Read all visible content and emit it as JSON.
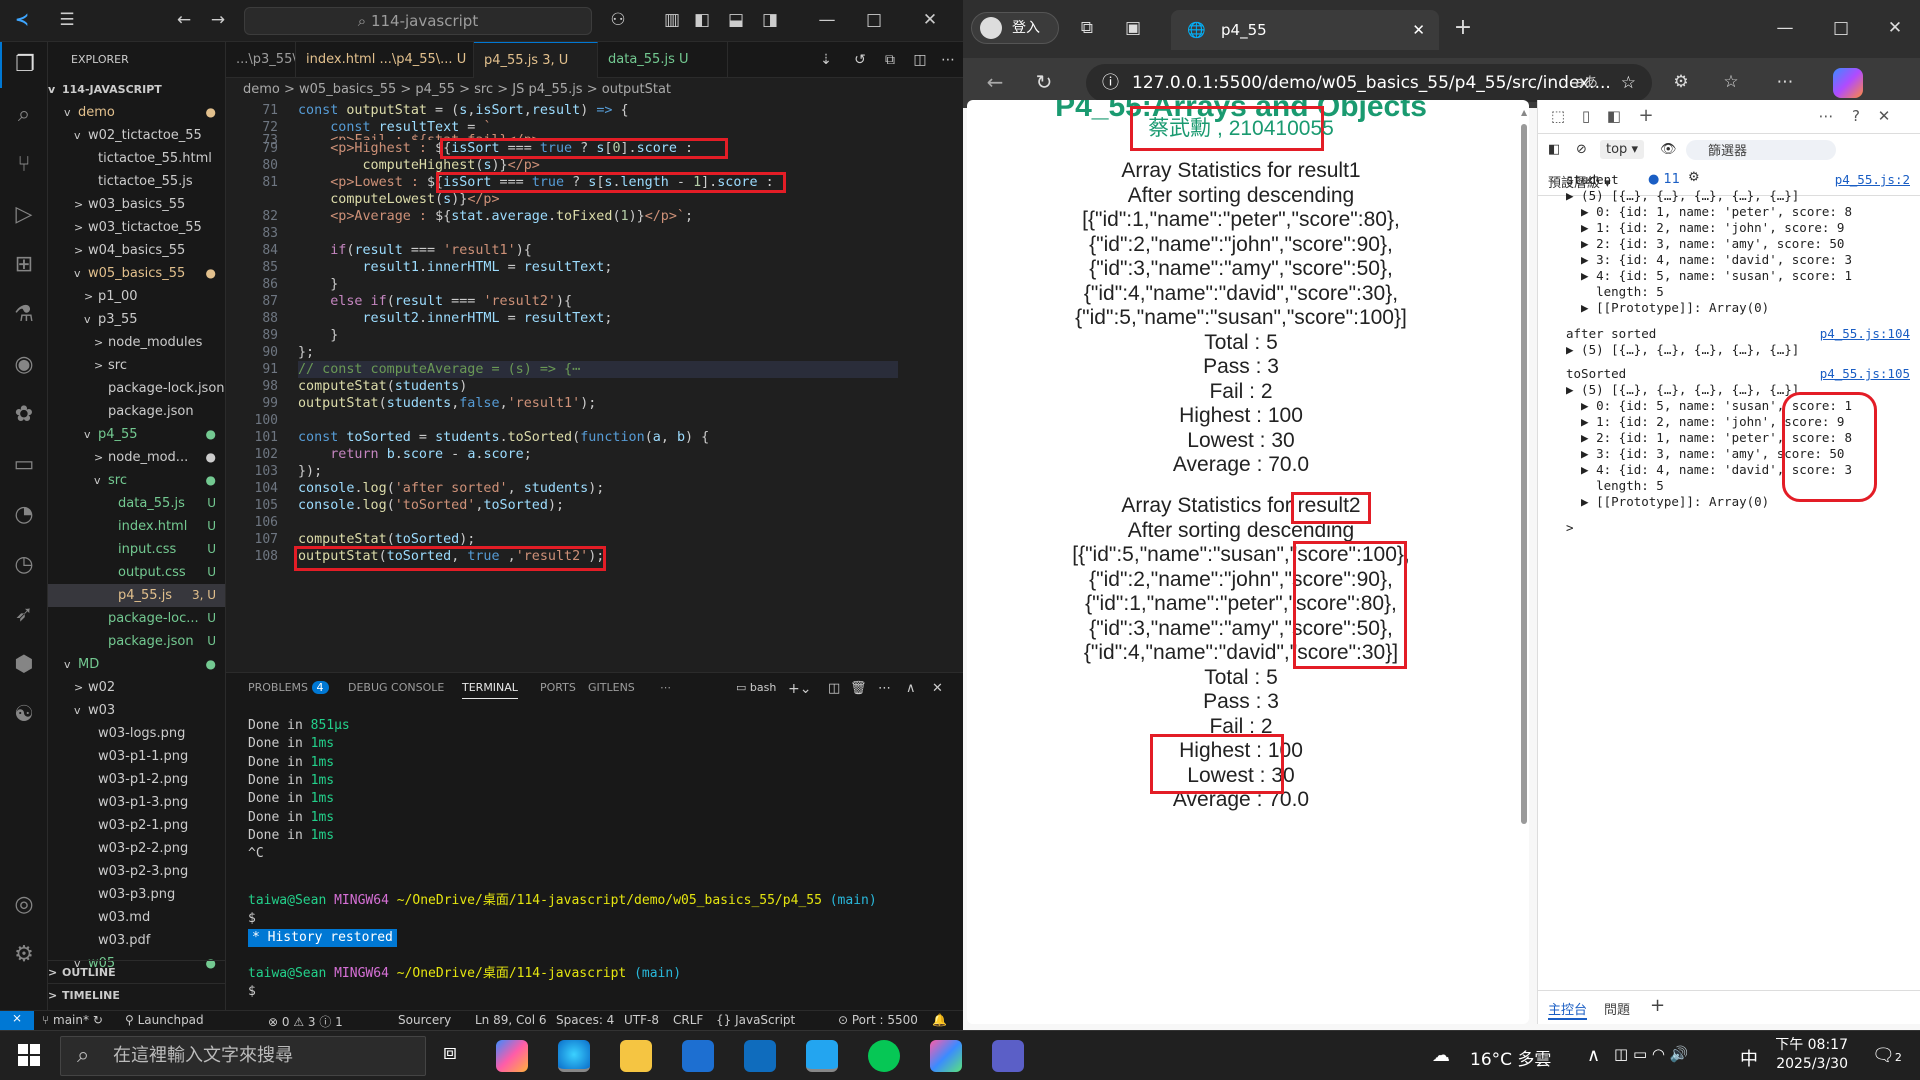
{
  "vscode": {
    "search_text": "114-javascript",
    "explorer_title": "EXPLORER",
    "root_label": "114-JAVASCRIPT",
    "tree": [
      {
        "label": "demo",
        "depth": 1,
        "arrow": "v",
        "badge": "●",
        "cls": "mod"
      },
      {
        "label": "w02_tictactoe_55",
        "depth": 2,
        "arrow": "v",
        "badge": "",
        "cls": ""
      },
      {
        "label": "tictactoe_55.html",
        "depth": 3,
        "arrow": "",
        "badge": "",
        "cls": ""
      },
      {
        "label": "tictactoe_55.js",
        "depth": 3,
        "arrow": "",
        "badge": "",
        "cls": ""
      },
      {
        "label": "w03_basics_55",
        "depth": 2,
        "arrow": ">",
        "badge": "",
        "cls": ""
      },
      {
        "label": "w03_tictactoe_55",
        "depth": 2,
        "arrow": ">",
        "badge": "",
        "cls": ""
      },
      {
        "label": "w04_basics_55",
        "depth": 2,
        "arrow": ">",
        "badge": "",
        "cls": ""
      },
      {
        "label": "w05_basics_55",
        "depth": 2,
        "arrow": "v",
        "badge": "●",
        "cls": "mod"
      },
      {
        "label": "p1_00",
        "depth": 3,
        "arrow": ">",
        "badge": "",
        "cls": ""
      },
      {
        "label": "p3_55",
        "depth": 3,
        "arrow": "v",
        "badge": "",
        "cls": ""
      },
      {
        "label": "node_modules",
        "depth": 4,
        "arrow": ">",
        "badge": "",
        "cls": ""
      },
      {
        "label": "src",
        "depth": 4,
        "arrow": ">",
        "badge": "",
        "cls": ""
      },
      {
        "label": "package-lock.json",
        "depth": 4,
        "arrow": "",
        "badge": "",
        "cls": ""
      },
      {
        "label": "package.json",
        "depth": 4,
        "arrow": "",
        "badge": "",
        "cls": ""
      },
      {
        "label": "p4_55",
        "depth": 3,
        "arrow": "v",
        "badge": "●",
        "cls": "untr"
      },
      {
        "label": "node_mod...",
        "depth": 4,
        "arrow": ">",
        "badge": "●",
        "cls": ""
      },
      {
        "label": "src",
        "depth": 4,
        "arrow": "v",
        "badge": "●",
        "cls": "untr"
      },
      {
        "label": "data_55.js",
        "depth": 5,
        "arrow": "",
        "badge": "U",
        "cls": "untr"
      },
      {
        "label": "index.html",
        "depth": 5,
        "arrow": "",
        "badge": "U",
        "cls": "untr"
      },
      {
        "label": "input.css",
        "depth": 5,
        "arrow": "",
        "badge": "U",
        "cls": "untr"
      },
      {
        "label": "output.css",
        "depth": 5,
        "arrow": "",
        "badge": "U",
        "cls": "untr"
      },
      {
        "label": "p4_55.js",
        "depth": 5,
        "arrow": "",
        "badge": "3, U",
        "cls": "mod sel"
      },
      {
        "label": "package-loc...",
        "depth": 4,
        "arrow": "",
        "badge": "U",
        "cls": "untr"
      },
      {
        "label": "package.json",
        "depth": 4,
        "arrow": "",
        "badge": "U",
        "cls": "untr"
      },
      {
        "label": "MD",
        "depth": 1,
        "arrow": "v",
        "badge": "●",
        "cls": "untr"
      },
      {
        "label": "w02",
        "depth": 2,
        "arrow": ">",
        "badge": "",
        "cls": ""
      },
      {
        "label": "w03",
        "depth": 2,
        "arrow": "v",
        "badge": "",
        "cls": ""
      },
      {
        "label": "w03-logs.png",
        "depth": 3,
        "arrow": "",
        "badge": "",
        "cls": ""
      },
      {
        "label": "w03-p1-1.png",
        "depth": 3,
        "arrow": "",
        "badge": "",
        "cls": ""
      },
      {
        "label": "w03-p1-2.png",
        "depth": 3,
        "arrow": "",
        "badge": "",
        "cls": ""
      },
      {
        "label": "w03-p1-3.png",
        "depth": 3,
        "arrow": "",
        "badge": "",
        "cls": ""
      },
      {
        "label": "w03-p2-1.png",
        "depth": 3,
        "arrow": "",
        "badge": "",
        "cls": ""
      },
      {
        "label": "w03-p2-2.png",
        "depth": 3,
        "arrow": "",
        "badge": "",
        "cls": ""
      },
      {
        "label": "w03-p2-3.png",
        "depth": 3,
        "arrow": "",
        "badge": "",
        "cls": ""
      },
      {
        "label": "w03-p3.png",
        "depth": 3,
        "arrow": "",
        "badge": "",
        "cls": ""
      },
      {
        "label": "w03.md",
        "depth": 3,
        "arrow": "",
        "badge": "",
        "cls": ""
      },
      {
        "label": "w03.pdf",
        "depth": 3,
        "arrow": "",
        "badge": "",
        "cls": ""
      },
      {
        "label": "w05",
        "depth": 2,
        "arrow": "v",
        "badge": "●",
        "cls": "untr"
      }
    ],
    "outline_label": "OUTLINE",
    "timeline_label": "TIMELINE",
    "tabs": [
      {
        "label": "...\\p3_55\\..."
      },
      {
        "label": "index.html ...\\p4_55\\... U"
      },
      {
        "label": "p4_55.js 3, U"
      },
      {
        "label": "data_55.js U"
      }
    ],
    "breadcrumb": "demo > w05_basics_55 > p4_55 > src > JS p4_55.js > outputStat",
    "line_numbers": [
      "71",
      "72",
      "73",
      "79",
      "80",
      "81",
      "",
      "82",
      "83",
      "84",
      "85",
      "86",
      "87",
      "88",
      "89",
      "90",
      "91",
      "98",
      "99",
      "100",
      "101",
      "102",
      "103",
      "104",
      "105",
      "106",
      "107",
      "108"
    ],
    "panel_tabs": [
      "PROBLEMS",
      "DEBUG CONSOLE",
      "TERMINAL",
      "PORTS",
      "GITLENS"
    ],
    "problems_count": "4",
    "terminal_shell": "bash",
    "terminal_lines": [
      {
        "a": "Done in ",
        "b": "851µs"
      },
      {
        "a": "Done in ",
        "b": "1ms"
      },
      {
        "a": "Done in ",
        "b": "1ms"
      },
      {
        "a": "Done in ",
        "b": "1ms"
      },
      {
        "a": "Done in ",
        "b": "1ms"
      },
      {
        "a": "Done in ",
        "b": "1ms"
      },
      {
        "a": "Done in ",
        "b": "1ms"
      },
      {
        "a": "^C",
        "b": ""
      }
    ],
    "prompt1_user": "taiwa@Sean",
    "prompt1_host": "MINGW64",
    "prompt1_path": "~/OneDrive/桌面/114-javascript/demo/w05_basics_55/p4_55",
    "prompt1_branch": "(main)",
    "dollar": "$",
    "history_restored": "History restored",
    "prompt2_path": "~/OneDrive/桌面/114-javascript",
    "prompt2_branch": "(main)",
    "status": {
      "branch": "main*",
      "launchpad": "Launchpad",
      "problems": "⊗ 0 ⚠ 3 ⓘ 1",
      "sourcery": "Sourcery",
      "position": "Ln 89, Col 6",
      "spaces": "Spaces: 4",
      "encoding": "UTF-8",
      "eol": "CRLF",
      "language": "{} JavaScript",
      "port": "Port : 5500"
    }
  },
  "browser": {
    "login": "登入",
    "tab_title": "p4_55",
    "url": "127.0.0.1:5500/demo/w05_basics_55/p4_55/src/index....",
    "page": {
      "heading": "P4_55:Arrays and Objects",
      "author": "蔡武勳 , 210410055",
      "block1": [
        "Array Statistics for result1",
        "After sorting descending",
        "[{\"id\":1,\"name\":\"peter\",\"score\":80},",
        "{\"id\":2,\"name\":\"john\",\"score\":90},",
        "{\"id\":3,\"name\":\"amy\",\"score\":50},",
        "{\"id\":4,\"name\":\"david\",\"score\":30},",
        "{\"id\":5,\"name\":\"susan\",\"score\":100}]",
        "Total : 5",
        "Pass : 3",
        "Fail : 2",
        "Highest : 100",
        "Lowest : 30",
        "Average : 70.0"
      ],
      "block2": [
        "Array Statistics for result2",
        "After sorting descending",
        "[{\"id\":5,\"name\":\"susan\",\"score\":100},",
        "{\"id\":2,\"name\":\"john\",\"score\":90},",
        "{\"id\":1,\"name\":\"peter\",\"score\":80},",
        "{\"id\":3,\"name\":\"amy\",\"score\":50},",
        "{\"id\":4,\"name\":\"david\",\"score\":30}]",
        "Total : 5",
        "Pass : 3",
        "Fail : 2",
        "Highest : 100",
        "Lowest : 30",
        "Average : 70.0"
      ]
    },
    "devtools": {
      "context": "top",
      "filter_placeholder": "篩選器",
      "levels": "預設層級",
      "issues_count": "11",
      "console": [
        {
          "t": "student",
          "link": "p4_55.js:2"
        },
        {
          "t": "▶ (5) [{…}, {…}, {…}, {…}, {…}]",
          "link": ""
        },
        {
          "t": "  ▶ 0: {id: 1, name: 'peter', score: 8",
          "link": ""
        },
        {
          "t": "  ▶ 1: {id: 2, name: 'john', score: 9",
          "link": ""
        },
        {
          "t": "  ▶ 2: {id: 3, name: 'amy', score: 50",
          "link": ""
        },
        {
          "t": "  ▶ 3: {id: 4, name: 'david', score: 3",
          "link": ""
        },
        {
          "t": "  ▶ 4: {id: 5, name: 'susan', score: 1",
          "link": ""
        },
        {
          "t": "    length: 5",
          "link": ""
        },
        {
          "t": "  ▶ [[Prototype]]: Array(0)",
          "link": ""
        },
        {
          "t": "after sorted",
          "link": "p4_55.js:104"
        },
        {
          "t": "▶ (5) [{…}, {…}, {…}, {…}, {…}]",
          "link": ""
        },
        {
          "t": "toSorted",
          "link": "p4_55.js:105"
        },
        {
          "t": "▶ (5) [{…}, {…}, {…}, {…}, {…}]",
          "link": ""
        },
        {
          "t": "  ▶ 0: {id: 5, name: 'susan', score: 1",
          "link": ""
        },
        {
          "t": "  ▶ 1: {id: 2, name: 'john', score: 9",
          "link": ""
        },
        {
          "t": "  ▶ 2: {id: 1, name: 'peter', score: 8",
          "link": ""
        },
        {
          "t": "  ▶ 3: {id: 3, name: 'amy', score: 50",
          "link": ""
        },
        {
          "t": "  ▶ 4: {id: 4, name: 'david', score: 3",
          "link": ""
        },
        {
          "t": "    length: 5",
          "link": ""
        },
        {
          "t": "  ▶ [[Prototype]]: Array(0)",
          "link": ""
        },
        {
          "t": ">",
          "link": ""
        }
      ],
      "bottom_tabs": [
        "主控台",
        "問題"
      ]
    }
  },
  "taskbar": {
    "search_placeholder": "在這裡輸入文字來搜尋",
    "weather": "16°C 多雲",
    "ime": "中",
    "time": "下午 08:17",
    "date": "2025/3/30",
    "notif": "2"
  }
}
